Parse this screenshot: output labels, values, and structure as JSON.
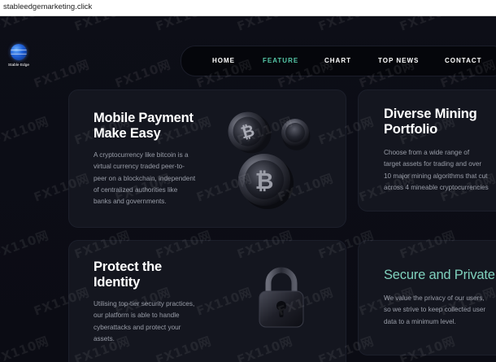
{
  "browser": {
    "url": "stableedgemarketing.click"
  },
  "brand": {
    "logo_text": "Stable Edge",
    "logo_icon": "globe-icon"
  },
  "nav": {
    "items": [
      {
        "label": "HOME",
        "active": false
      },
      {
        "label": "FEATURE",
        "active": true
      },
      {
        "label": "CHART",
        "active": false
      },
      {
        "label": "TOP NEWS",
        "active": false
      },
      {
        "label": "CONTACT",
        "active": false
      }
    ],
    "active_color": "#55c7a8"
  },
  "features": [
    {
      "title": "Mobile Payment Make Easy",
      "title_lines": [
        "Mobile Payment",
        "Make Easy"
      ],
      "text_lines": [
        "A cryptocurrency like bitcoin is a",
        "virtual currency traded peer-to-",
        "peer on a blockchain, independent",
        "of centralized authorities like",
        "banks and governments."
      ],
      "illustration": "bitcoin-coins-icon"
    },
    {
      "title": "Diverse Mining Portfolio",
      "title_lines": [
        "Diverse Mining",
        "Portfolio"
      ],
      "text_lines": [
        "Choose from a wide range of",
        "target assets for trading and over",
        "10 major mining algorithms that cut",
        "across 4 mineable cryptocurrencies"
      ]
    },
    {
      "title": "Protect the Identity",
      "title_lines": [
        "Protect the",
        "Identity"
      ],
      "text_lines": [
        "Utilising top-tier security practices,",
        "our platform is able to handle",
        "cyberattacks and protect your",
        "assets."
      ],
      "illustration": "padlock-icon"
    },
    {
      "title": "Secure and Private",
      "title_lines": [
        "Secure and Private"
      ],
      "title_color": "#7fd1bd",
      "text_lines": [
        "We value the privacy of our users,",
        "so we strive to keep collected user",
        "data to a minimum level."
      ]
    }
  ],
  "watermark": {
    "text": "FX110网"
  },
  "colors": {
    "background": "#0b0c14",
    "card": "#14161f",
    "accent": "#55c7a8",
    "muted_text": "#9a9ea9"
  }
}
